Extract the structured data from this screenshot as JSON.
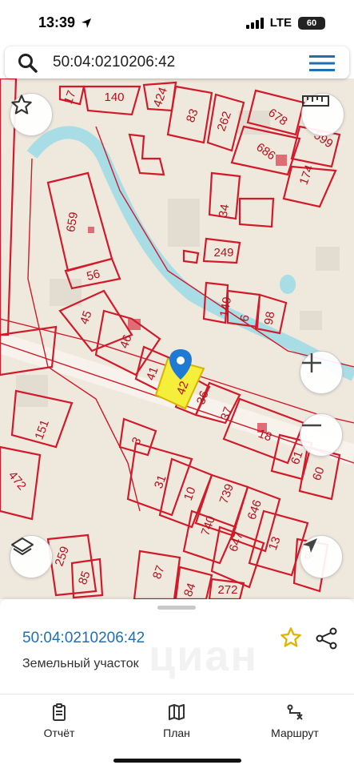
{
  "status_bar": {
    "time": "13:39",
    "network": "LTE",
    "battery": "60"
  },
  "search": {
    "query": "50:04:0210206:42"
  },
  "map": {
    "parcel_labels": [
      "17",
      "140",
      "424",
      "83",
      "262",
      "678",
      "686",
      "599",
      "174",
      "34",
      "249",
      "659",
      "56",
      "45",
      "46",
      "41",
      "42",
      "36",
      "37",
      "149",
      "6",
      "98",
      "18",
      "61",
      "60",
      "151",
      "3",
      "31",
      "10",
      "739",
      "646",
      "740",
      "647",
      "13",
      "472",
      "259",
      "85",
      "87",
      "84",
      "272",
      "8"
    ],
    "selected_parcel": "42",
    "colors": {
      "boundary": "#d11a2a",
      "selected_fill": "#f5ee3b",
      "river": "#a8dde6",
      "pin": "#1f7ad6"
    }
  },
  "sheet": {
    "cadastral_number": "50:04:0210206:42",
    "object_type": "Земельный участок",
    "watermark": "циан"
  },
  "tabs": [
    {
      "label": "Отчёт",
      "icon": "report-icon"
    },
    {
      "label": "План",
      "icon": "map-icon"
    },
    {
      "label": "Маршрут",
      "icon": "route-icon"
    }
  ]
}
